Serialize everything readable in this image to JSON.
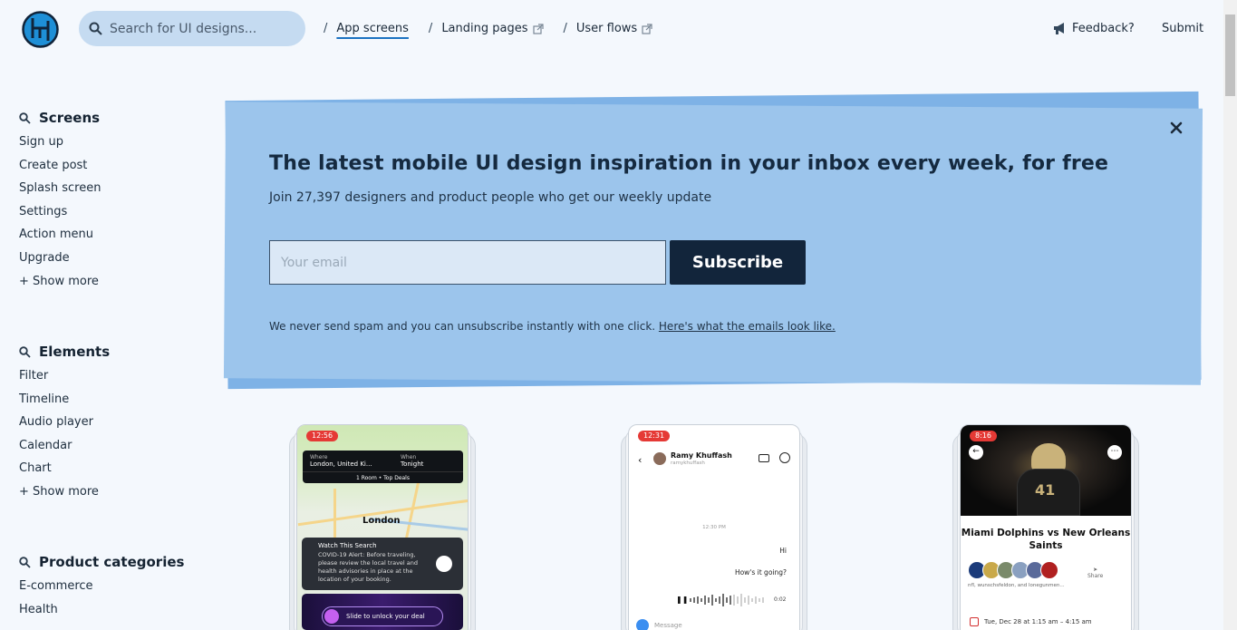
{
  "header": {
    "search_placeholder": "Search for UI designs...",
    "breadcrumbs": [
      {
        "sep": "/",
        "label": "App screens"
      },
      {
        "sep": "/",
        "label": "Landing pages"
      },
      {
        "sep": "/",
        "label": "User flows"
      }
    ],
    "feedback": "Feedback?",
    "submit": "Submit"
  },
  "sidebar": {
    "screens": {
      "title": "Screens",
      "items": [
        "Sign up",
        "Create post",
        "Splash screen",
        "Settings",
        "Action menu",
        "Upgrade",
        "+ Show more"
      ]
    },
    "elements": {
      "title": "Elements",
      "items": [
        "Filter",
        "Timeline",
        "Audio player",
        "Calendar",
        "Chart",
        "+ Show more"
      ]
    },
    "categories": {
      "title": "Product categories",
      "items": [
        "E-commerce",
        "Health"
      ]
    }
  },
  "banner": {
    "title": "The latest mobile UI design inspiration in your inbox every week, for free",
    "subtitle": "Join 27,397 designers and product people who get our weekly update",
    "email_placeholder": "Your email",
    "subscribe": "Subscribe",
    "note": "We never send spam and you can unsubscribe instantly with one click.",
    "note_link": "Here's what the emails look like.",
    "close_icon": "close-icon"
  },
  "cards": {
    "hotel": {
      "time": "12:56",
      "where_label": "Where",
      "where_value": "London, United Ki...",
      "when_label": "When",
      "when_value": "Tonight",
      "room_line": "1 Room • Top Deals",
      "city": "London",
      "alert_title": "Watch This Search",
      "alert_text": "COVID-19 Alert: Before traveling, please review the local travel and health advisories in place at the location of your booking.",
      "slide_text": "Slide to unlock your deal"
    },
    "chat": {
      "time": "12:31",
      "name": "Ramy Khuffash",
      "handle": "ramykhuffash",
      "timestamp": "12:30 PM",
      "msg1": "Hi",
      "msg2": "How's it going?",
      "duration": "0:02",
      "message_placeholder": "Message"
    },
    "sports": {
      "time": "8:16",
      "jersey": "41",
      "title": "Miami Dolphins vs New Orleans Saints",
      "participants": "nfl, wunschsfeldon, and lonegunmen...",
      "share": "Share",
      "date": "Tue, Dec 28 at 1:15 am – 4:15 am"
    }
  },
  "colors": {
    "background": "#f4f8fd",
    "banner": "#9cc5ec",
    "banner_back": "#7eb2e6",
    "subscribe_bg": "#12253b",
    "accent": "#1b72c2"
  }
}
